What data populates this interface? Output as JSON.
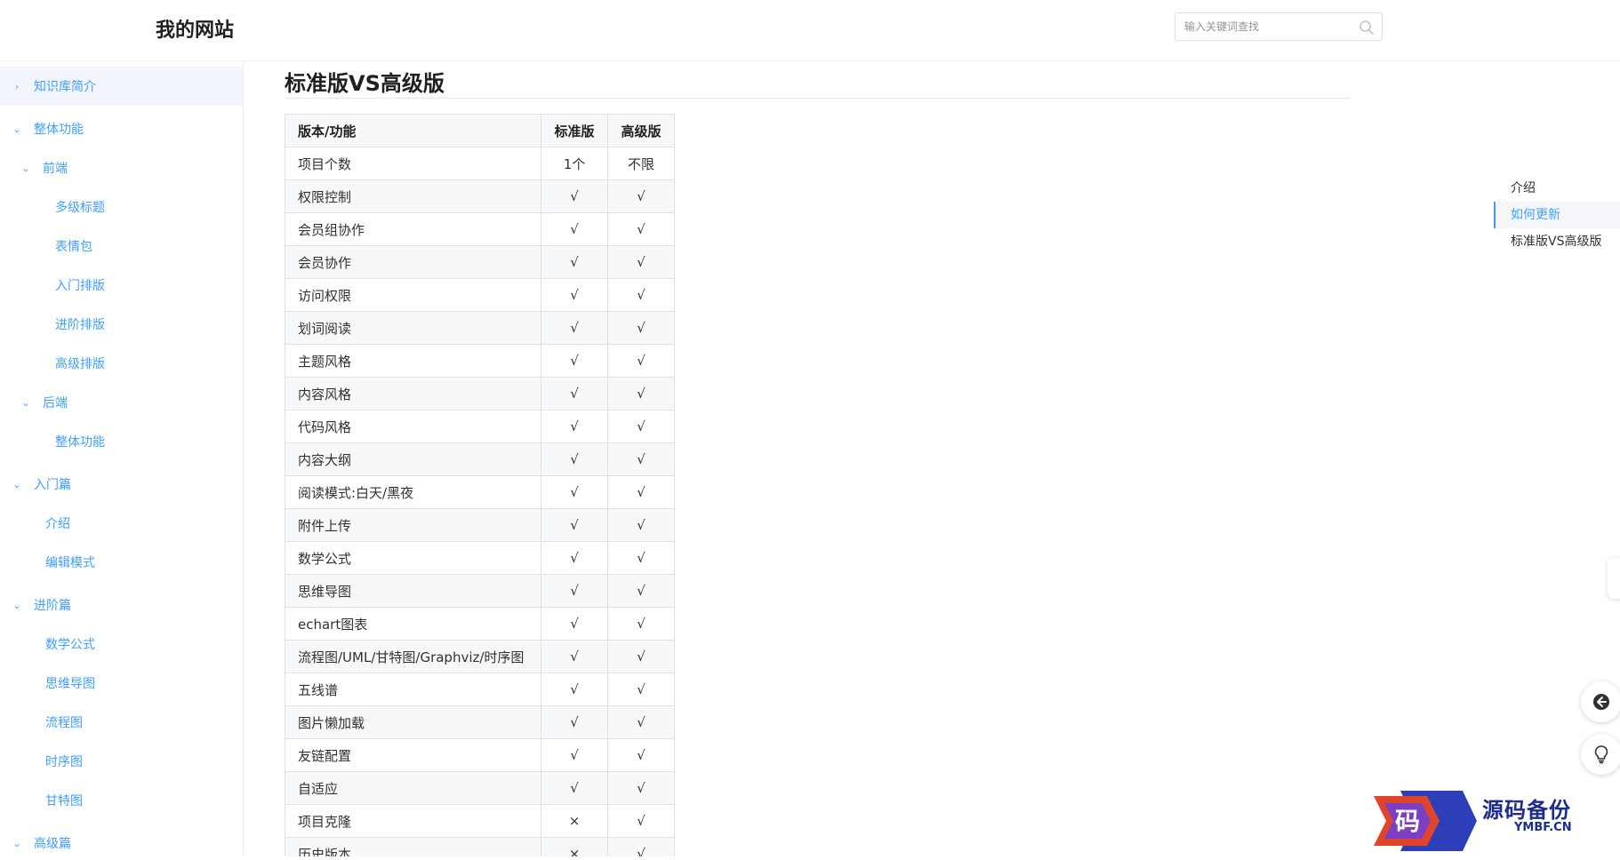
{
  "header": {
    "site_title": "我的网站",
    "search_placeholder": "输入关键词查找"
  },
  "sidebar": {
    "items": [
      {
        "label": "知识库简介",
        "icon": "chevron-right-icon"
      },
      {
        "label": "整体功能",
        "icon": "chevron-down-icon"
      },
      {
        "label": "前端",
        "icon": "chevron-down-icon"
      },
      {
        "label": "多级标题"
      },
      {
        "label": "表情包"
      },
      {
        "label": "入门排版"
      },
      {
        "label": "进阶排版"
      },
      {
        "label": "高级排版"
      },
      {
        "label": "后端",
        "icon": "chevron-down-icon"
      },
      {
        "label": "整体功能"
      },
      {
        "label": "入门篇",
        "icon": "chevron-down-icon"
      },
      {
        "label": "介绍"
      },
      {
        "label": "编辑模式"
      },
      {
        "label": "进阶篇",
        "icon": "chevron-down-icon"
      },
      {
        "label": "数学公式"
      },
      {
        "label": "思维导图"
      },
      {
        "label": "流程图"
      },
      {
        "label": "时序图"
      },
      {
        "label": "甘特图"
      },
      {
        "label": "高级篇",
        "icon": "chevron-down-icon"
      }
    ]
  },
  "content": {
    "heading": "标准版VS高级版",
    "table": {
      "headers": [
        "版本/功能",
        "标准版",
        "高级版"
      ],
      "rows": [
        [
          "项目个数",
          "1个",
          "不限"
        ],
        [
          "权限控制",
          "√",
          "√"
        ],
        [
          "会员组协作",
          "√",
          "√"
        ],
        [
          "会员协作",
          "√",
          "√"
        ],
        [
          "访问权限",
          "√",
          "√"
        ],
        [
          "划词阅读",
          "√",
          "√"
        ],
        [
          "主题风格",
          "√",
          "√"
        ],
        [
          "内容风格",
          "√",
          "√"
        ],
        [
          "代码风格",
          "√",
          "√"
        ],
        [
          "内容大纲",
          "√",
          "√"
        ],
        [
          "阅读模式:白天/黑夜",
          "√",
          "√"
        ],
        [
          "附件上传",
          "√",
          "√"
        ],
        [
          "数学公式",
          "√",
          "√"
        ],
        [
          "思维导图",
          "√",
          "√"
        ],
        [
          "echart图表",
          "√",
          "√"
        ],
        [
          "流程图/UML/甘特图/Graphviz/时序图",
          "√",
          "√"
        ],
        [
          "五线谱",
          "√",
          "√"
        ],
        [
          "图片懒加载",
          "√",
          "√"
        ],
        [
          "友链配置",
          "√",
          "√"
        ],
        [
          "自适应",
          "√",
          "√"
        ],
        [
          "项目克隆",
          "×",
          "√"
        ],
        [
          "历史版本",
          "×",
          "√"
        ]
      ]
    }
  },
  "toc": {
    "items": [
      "介绍",
      "如何更新",
      "标准版VS高级版"
    ],
    "active_index": 1
  },
  "float_buttons": [
    "arrow-left-circle-icon",
    "lightbulb-icon"
  ],
  "watermark": {
    "char": "码",
    "text": "源码备份",
    "sub": "YMBF.CN"
  },
  "colors": {
    "accent": "#409eff",
    "border": "#dfe2e5",
    "row_alt": "#f6f8fa"
  }
}
